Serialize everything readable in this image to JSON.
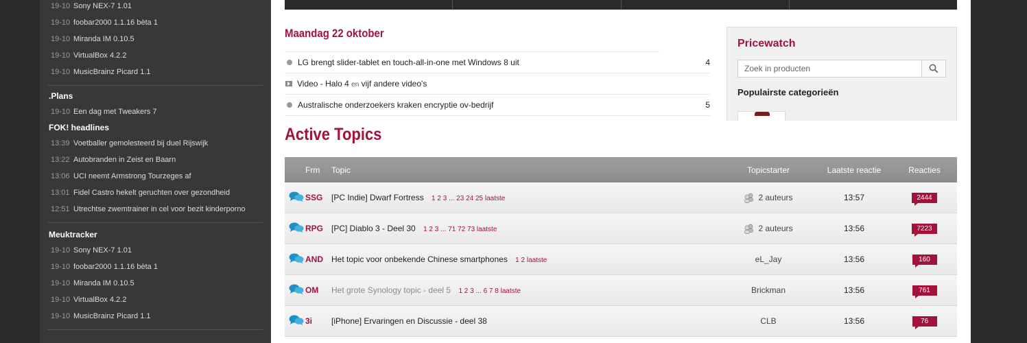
{
  "sidebar": {
    "top_items": [
      {
        "date": "19-10",
        "text": "Sony NEX-7 1.01"
      },
      {
        "date": "19-10",
        "text": "foobar2000 1.1.16 bèta 1"
      },
      {
        "date": "19-10",
        "text": "Miranda IM 0.10.5"
      },
      {
        "date": "19-10",
        "text": "VirtualBox 4.2.2"
      },
      {
        "date": "19-10",
        "text": "MusicBrainz Picard 1.1"
      }
    ],
    "plans_heading": ".Plans",
    "plans_items": [
      {
        "date": "19-10",
        "text": "Een dag met Tweakers 7"
      }
    ],
    "fok_heading": "FOK! headlines",
    "fok_items": [
      {
        "date": "13:39",
        "text": "Voetballer gemolesteerd bij duel Rijswijk"
      },
      {
        "date": "13:22",
        "text": "Autobranden in Zeist en Baarn"
      },
      {
        "date": "13:06",
        "text": "UCI neemt Armstrong Tourzeges af"
      },
      {
        "date": "13:01",
        "text": "Fidel Castro hekelt geruchten over gezondheid"
      },
      {
        "date": "12:51",
        "text": "Utrechtse zwemtrainer in cel voor bezit kinderporno"
      }
    ],
    "meuk_heading": "Meuktracker",
    "meuk_items": [
      {
        "date": "19-10",
        "text": "Sony NEX-7 1.01"
      },
      {
        "date": "19-10",
        "text": "foobar2000 1.1.16 bèta 1"
      },
      {
        "date": "19-10",
        "text": "Miranda IM 0.10.5"
      },
      {
        "date": "19-10",
        "text": "VirtualBox 4.2.2"
      },
      {
        "date": "19-10",
        "text": "MusicBrainz Picard 1.1"
      }
    ]
  },
  "news": {
    "date_heading": "Maandag 22 oktober",
    "items": [
      {
        "type": "bullet",
        "title": "LG brengt slider-tablet en touch-all-in-one met Windows 8 uit",
        "count": "4"
      },
      {
        "type": "video",
        "title_a": "Video - Halo 4",
        "title_mid": "en",
        "title_b": "vijf andere video's",
        "count": ""
      },
      {
        "type": "bullet",
        "title": "Australische onderzoekers kraken encryptie ov-bedrijf",
        "count": "5"
      }
    ]
  },
  "pricewatch": {
    "title": "Pricewatch",
    "search_placeholder": "Zoek in producten",
    "popular_heading": "Populairste categorieën"
  },
  "active_topics": {
    "title": "Active Topics",
    "headers": {
      "frm": "Frm",
      "topic": "Topic",
      "starter": "Topicstarter",
      "last": "Laatste reactie",
      "reactions": "Reacties"
    },
    "rows": [
      {
        "frm": "SSG",
        "topic": "[PC Indie] Dwarf Fortress",
        "pages": "1 2 3 ... 23 24 25 laatste",
        "starter": "2 auteurs",
        "multi": true,
        "last": "13:57",
        "reactions": "2444",
        "visited": false
      },
      {
        "frm": "RPG",
        "topic": "[PC] Diablo 3 - Deel 30",
        "pages": "1 2 3 ... 71 72 73 laatste",
        "starter": "2 auteurs",
        "multi": true,
        "last": "13:56",
        "reactions": "7223",
        "visited": false
      },
      {
        "frm": "AND",
        "topic": "Het topic voor onbekende Chinese smartphones",
        "pages": "1 2 laatste",
        "starter": "eL_Jay",
        "multi": false,
        "last": "13:56",
        "reactions": "160",
        "visited": false
      },
      {
        "frm": "OM",
        "topic": "Het grote Synology topic - deel 5",
        "pages": "1 2 3 ... 6 7 8 laatste",
        "starter": "Brickman",
        "multi": false,
        "last": "13:56",
        "reactions": "761",
        "visited": true
      },
      {
        "frm": "3i",
        "topic": "[iPhone] Ervaringen en Discussie - deel 38",
        "pages": "",
        "starter": "CLB",
        "multi": false,
        "last": "13:56",
        "reactions": "76",
        "visited": false
      }
    ]
  },
  "colors": {
    "brand": "#a3123a",
    "sidebar_bg": "#383838",
    "page_bg": "#2b2b2b"
  }
}
